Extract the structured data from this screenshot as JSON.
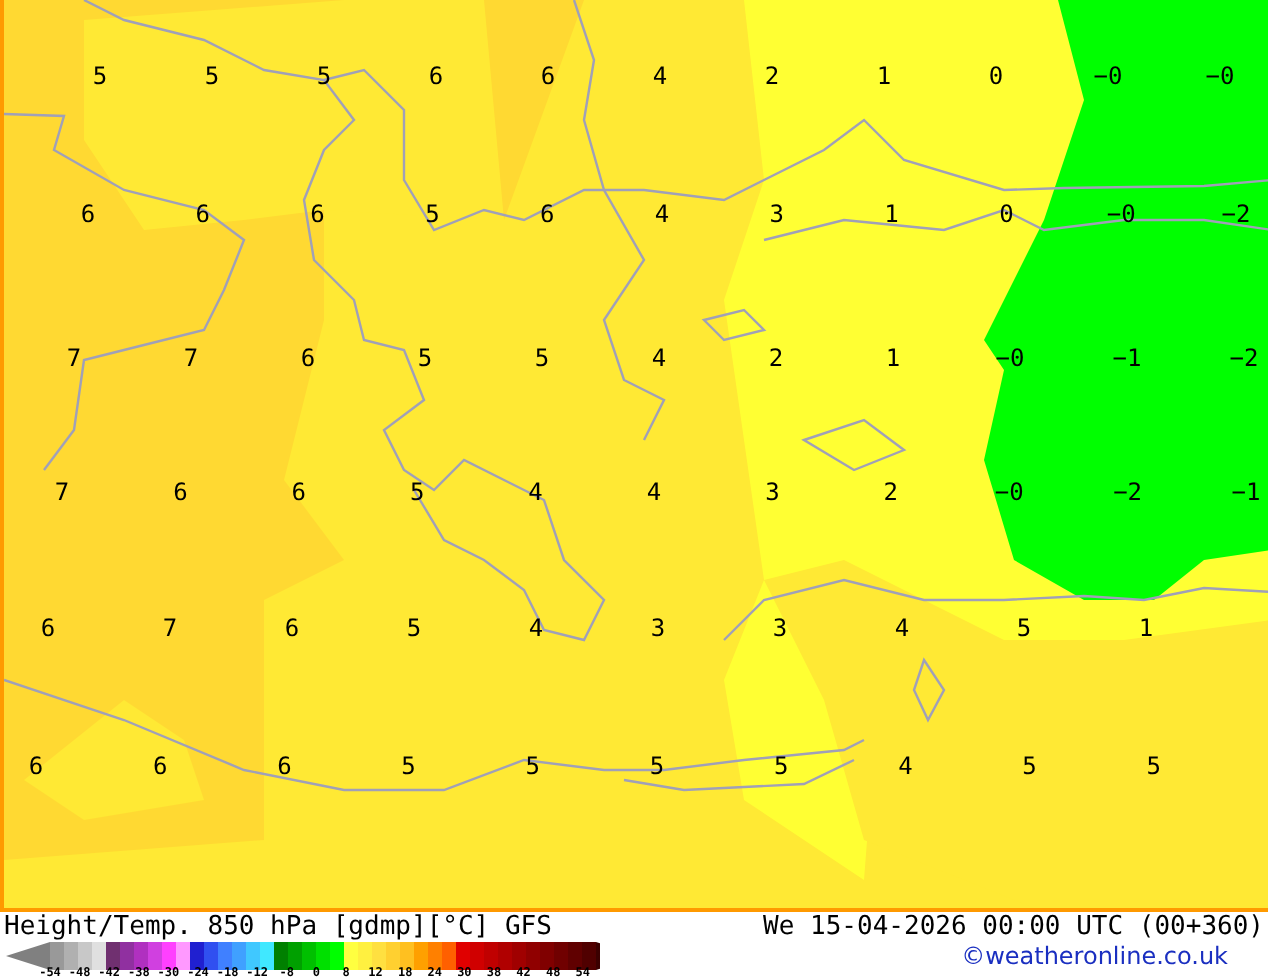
{
  "map": {
    "label_rows": [
      [
        "5",
        "5",
        "5",
        "6",
        "6",
        "4",
        "2",
        "1",
        "0",
        "−0",
        "−0"
      ],
      [
        "6",
        "6",
        "6",
        "5",
        "6",
        "4",
        "3",
        "1",
        "0",
        "−0",
        "−2"
      ],
      [
        "7",
        "7",
        "6",
        "5",
        "5",
        "4",
        "2",
        "1",
        "−0",
        "−1",
        "−2"
      ],
      [
        "7",
        "6",
        "6",
        "5",
        "4",
        "4",
        "3",
        "2",
        "−0",
        "−2",
        "−1"
      ],
      [
        "6",
        "7",
        "6",
        "5",
        "4",
        "3",
        "3",
        "4",
        "5",
        "1"
      ],
      [
        "6",
        "6",
        "6",
        "5",
        "5",
        "5",
        "5",
        "4",
        "5",
        "5"
      ]
    ]
  },
  "footer": {
    "title": "Height/Temp. 850 hPa [gdmp][°C] GFS",
    "datetime": "We 15-04-2026 00:00 UTC (00+360)",
    "credit": "©weatheronline.co.uk",
    "legend": {
      "swatches": [
        {
          "color": "#808080"
        },
        {
          "color": "#999999"
        },
        {
          "color": "#b0b0b0"
        },
        {
          "color": "#c8c8c8"
        },
        {
          "color": "#e0e0e0"
        },
        {
          "color": "#703070"
        },
        {
          "color": "#9030a0"
        },
        {
          "color": "#b030c0"
        },
        {
          "color": "#d040e0"
        },
        {
          "color": "#ff40ff"
        },
        {
          "color": "#ff99ff"
        },
        {
          "color": "#2020d0"
        },
        {
          "color": "#3050f0"
        },
        {
          "color": "#4080ff"
        },
        {
          "color": "#40a0ff"
        },
        {
          "color": "#40c8ff"
        },
        {
          "color": "#40e8ff"
        },
        {
          "color": "#008000"
        },
        {
          "color": "#00a000"
        },
        {
          "color": "#00c000"
        },
        {
          "color": "#00e000"
        },
        {
          "color": "#00ff00"
        },
        {
          "color": "#ffff40"
        },
        {
          "color": "#fff040"
        },
        {
          "color": "#ffe040"
        },
        {
          "color": "#ffd030"
        },
        {
          "color": "#ffc020"
        },
        {
          "color": "#ffa000"
        },
        {
          "color": "#ff8000"
        },
        {
          "color": "#ff6000"
        },
        {
          "color": "#e00000"
        },
        {
          "color": "#d00000"
        },
        {
          "color": "#c00000"
        },
        {
          "color": "#b00000"
        },
        {
          "color": "#a00000"
        },
        {
          "color": "#900000"
        },
        {
          "color": "#800000"
        },
        {
          "color": "#700000"
        },
        {
          "color": "#600000"
        },
        {
          "color": "#500000"
        },
        {
          "color": "#3a0000"
        }
      ],
      "ticks": [
        "-54",
        "-48",
        "-42",
        "-38",
        "-30",
        "-24",
        "-18",
        "-12",
        "-8",
        "0",
        "8",
        "12",
        "18",
        "24",
        "30",
        "38",
        "42",
        "48",
        "54"
      ]
    }
  }
}
